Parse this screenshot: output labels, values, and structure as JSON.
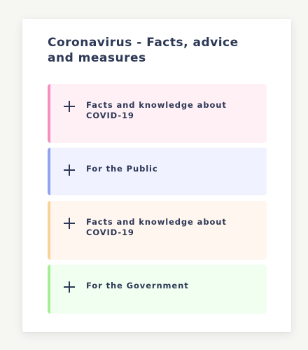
{
  "card": {
    "title": "Coronavirus - Facts, advice and measures"
  },
  "accordion": {
    "items": [
      {
        "label": "Facts and knowledge about COVID-19",
        "icon": "plus-icon",
        "accent": "#f48fbf",
        "background": "#fff0f6"
      },
      {
        "label": "For the Public",
        "icon": "plus-icon",
        "accent": "#8fa3f0",
        "background": "#f0f2ff"
      },
      {
        "label": "Facts and knowledge about COVID-19",
        "icon": "plus-icon",
        "accent": "#f9d396",
        "background": "#fff6ef"
      },
      {
        "label": "For the Government",
        "icon": "plus-icon",
        "accent": "#a6ee96",
        "background": "#f0fff0"
      }
    ]
  }
}
